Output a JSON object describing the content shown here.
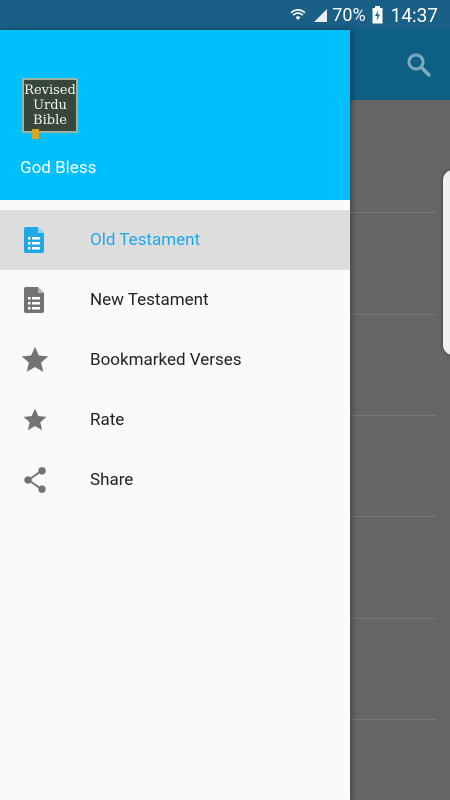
{
  "status_bar": {
    "battery": "70%",
    "time": "14:37",
    "icons": [
      "wifi-icon",
      "signal-icon",
      "battery-charging-icon"
    ]
  },
  "drawer": {
    "header": {
      "logo_lines": [
        "Revised",
        "Urdu",
        "Bible"
      ],
      "title": "God Bless",
      "color": "#00bfff"
    },
    "items": [
      {
        "label": "Old Testament",
        "icon": "document-list-icon",
        "active": true
      },
      {
        "label": "New Testament",
        "icon": "document-list-icon",
        "active": false
      },
      {
        "label": "Bookmarked Verses",
        "icon": "star-icon",
        "active": false
      },
      {
        "label": "Rate",
        "icon": "star-icon",
        "active": false
      },
      {
        "label": "Share",
        "icon": "share-icon",
        "active": false
      }
    ]
  },
  "colors": {
    "accent": "#1ea8e8",
    "status_bar": "#1a5f86",
    "toolbar": "#0d5f83"
  }
}
